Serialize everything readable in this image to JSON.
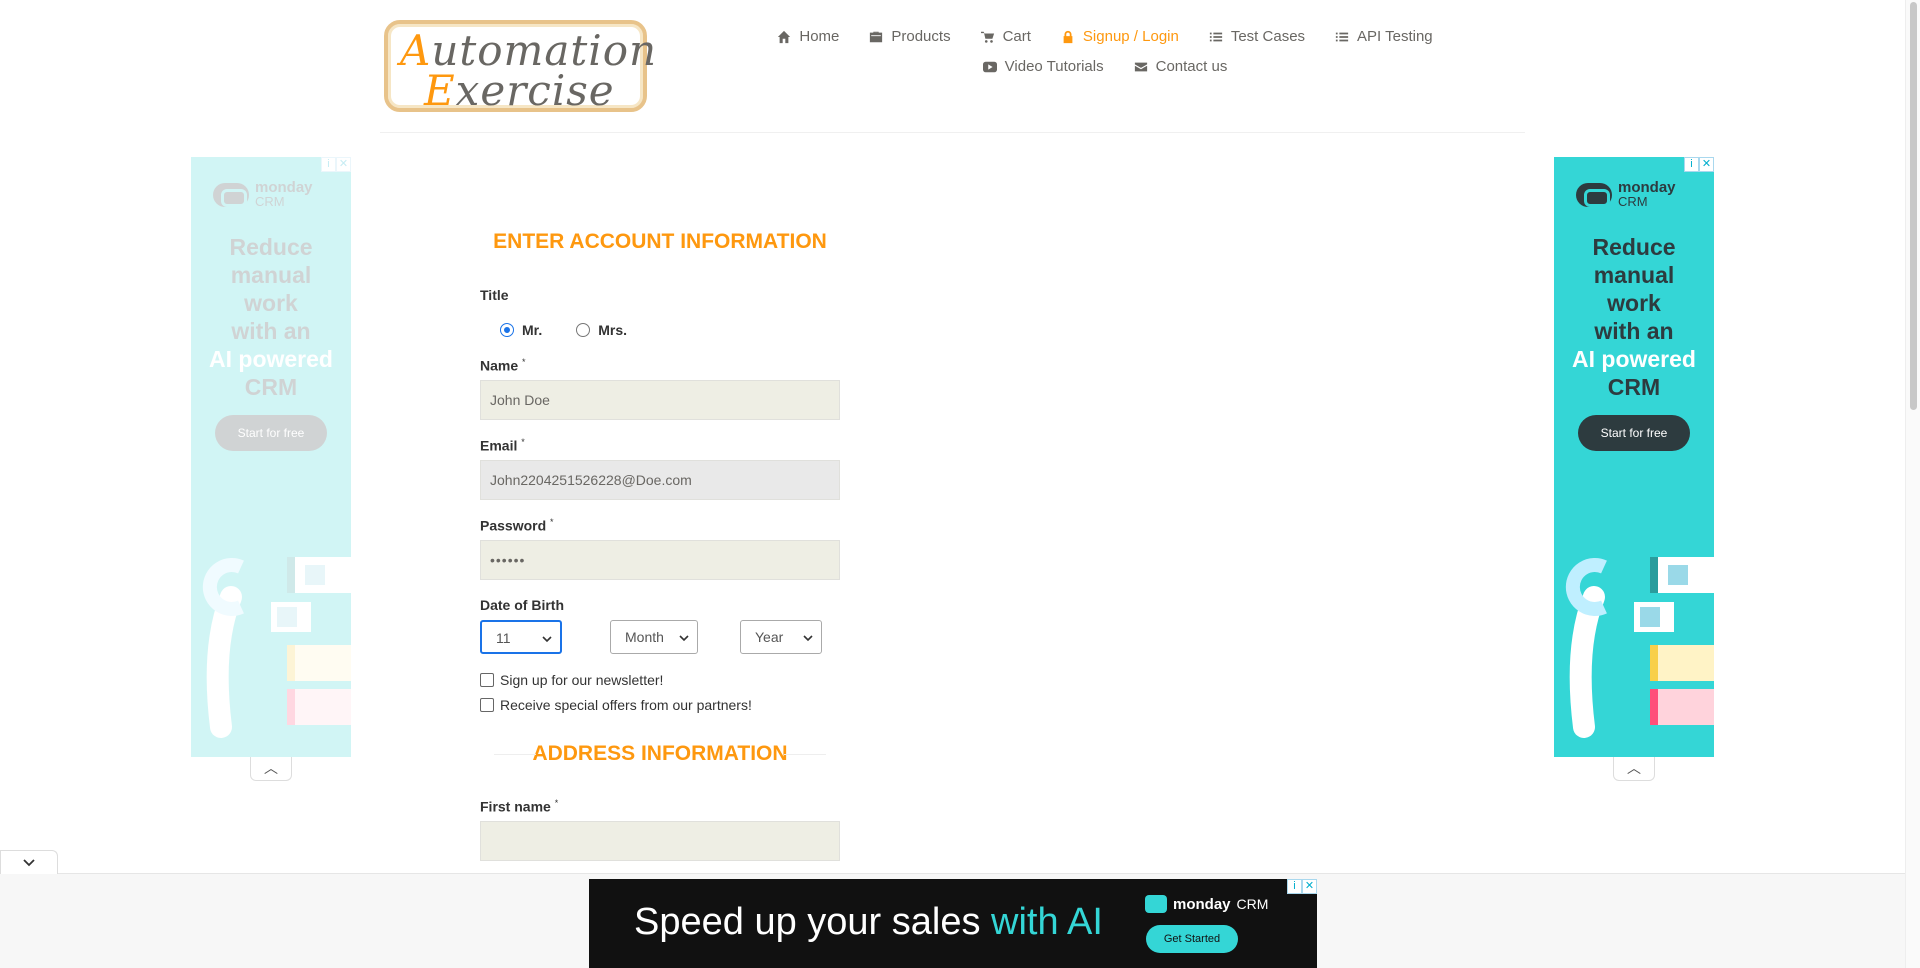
{
  "logo": {
    "line1_cap": "A",
    "line1_rest": "utomation",
    "line2_cap": "E",
    "line2_rest": "xercise"
  },
  "nav": {
    "row1": [
      {
        "label": "Home",
        "icon": "home-icon"
      },
      {
        "label": "Products",
        "icon": "briefcase-icon"
      },
      {
        "label": "Cart",
        "icon": "cart-icon"
      },
      {
        "label": "Signup / Login",
        "icon": "lock-icon",
        "active": true
      },
      {
        "label": "Test Cases",
        "icon": "list-icon"
      },
      {
        "label": "API Testing",
        "icon": "list-icon"
      }
    ],
    "row2": [
      {
        "label": "Video Tutorials",
        "icon": "youtube-icon"
      },
      {
        "label": "Contact us",
        "icon": "envelope-icon"
      }
    ]
  },
  "ad": {
    "brand": "monday",
    "brand_sub": "CRM",
    "headline_dark": [
      "Reduce",
      "manual",
      "work",
      "with an"
    ],
    "headline_light": "AI powered",
    "headline_end": "CRM",
    "cta": "Start for free",
    "badge_info": "i",
    "badge_close": "✕",
    "toggle": "︿"
  },
  "form": {
    "account_title": "ENTER ACCOUNT INFORMATION",
    "title_label": "Title",
    "title_options": [
      "Mr.",
      "Mrs."
    ],
    "title_selected": "Mr.",
    "name_label": "Name",
    "name_value": "John Doe",
    "email_label": "Email",
    "email_value": "John2204251526228@Doe.com",
    "password_label": "Password",
    "password_value": "••••••",
    "required_mark": "*",
    "dob_label": "Date of Birth",
    "dob_day": "11",
    "dob_month": "Month",
    "dob_year": "Year",
    "newsletter_label": "Sign up for our newsletter!",
    "offers_label": "Receive special offers from our partners!",
    "address_title": "ADDRESS INFORMATION",
    "first_name_label": "First name",
    "first_name_value": ""
  },
  "bottom_ad": {
    "headline_plain": "Speed up your sales ",
    "headline_accent": "with AI",
    "brand": "monday",
    "brand_sub": "CRM",
    "cta": "Get Started"
  },
  "colors": {
    "accent": "#fe980f",
    "ad_teal": "#34d6d6",
    "ad_dark": "#2d3b3f"
  }
}
